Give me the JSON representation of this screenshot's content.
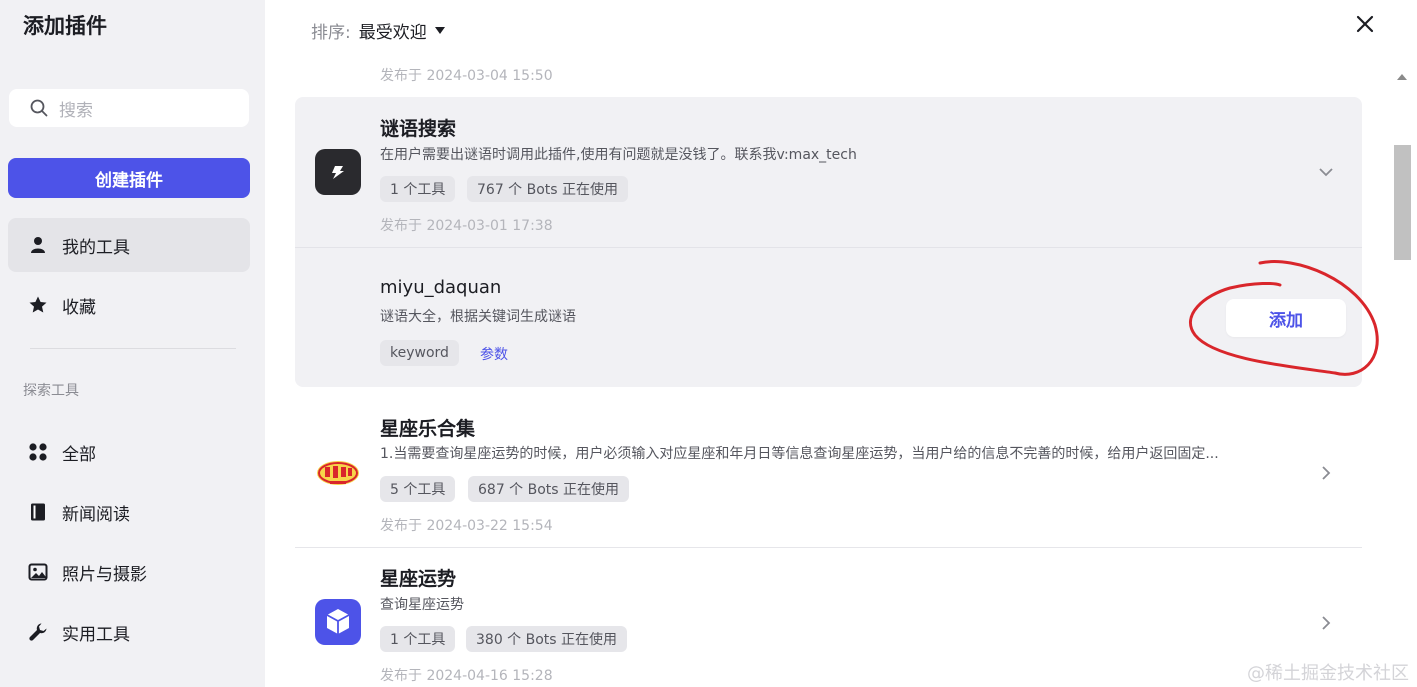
{
  "sidebar": {
    "title": "添加插件",
    "search_placeholder": "搜索",
    "create_button": "创建插件",
    "items": [
      {
        "label": "我的工具",
        "icon": "user-icon"
      },
      {
        "label": "收藏",
        "icon": "star-icon"
      }
    ],
    "section_label": "探索工具",
    "explore_items": [
      {
        "label": "全部",
        "icon": "grid-icon"
      },
      {
        "label": "新闻阅读",
        "icon": "book-icon"
      },
      {
        "label": "照片与摄影",
        "icon": "image-icon"
      },
      {
        "label": "实用工具",
        "icon": "wrench-icon"
      }
    ]
  },
  "main": {
    "sort_label": "排序:",
    "sort_value": "最受欢迎",
    "prev_published": "发布于 2024-03-04 15:50",
    "plugins": [
      {
        "title": "谜语搜索",
        "desc": "在用户需要出谜语时调用此插件,使用有问题就是没钱了。联系我v:max_tech",
        "tags": [
          "1 个工具",
          "767 个 Bots 正在使用"
        ],
        "published": "发布于 2024-03-01 17:38",
        "tool": {
          "name": "miyu_daquan",
          "desc": "谜语大全，根据关键词生成谜语",
          "param_tag": "keyword",
          "param_link": "参数",
          "add_button": "添加"
        }
      },
      {
        "title": "星座乐合集",
        "desc": "1.当需要查询星座运势的时候，用户必须输入对应星座和年月日等信息查询星座运势，当用户给的信息不完善的时候，给用户返回固定...",
        "tags": [
          "5 个工具",
          "687 个 Bots 正在使用"
        ],
        "published": "发布于 2024-03-22 15:54"
      },
      {
        "title": "星座运势",
        "desc": "查询星座运势",
        "tags": [
          "1 个工具",
          "380 个 Bots 正在使用"
        ],
        "published": "发布于 2024-04-16 15:28"
      }
    ]
  },
  "watermark": "@稀土掘金技术社区",
  "colors": {
    "accent": "#4d53e8",
    "annotation": "#d9262b"
  }
}
